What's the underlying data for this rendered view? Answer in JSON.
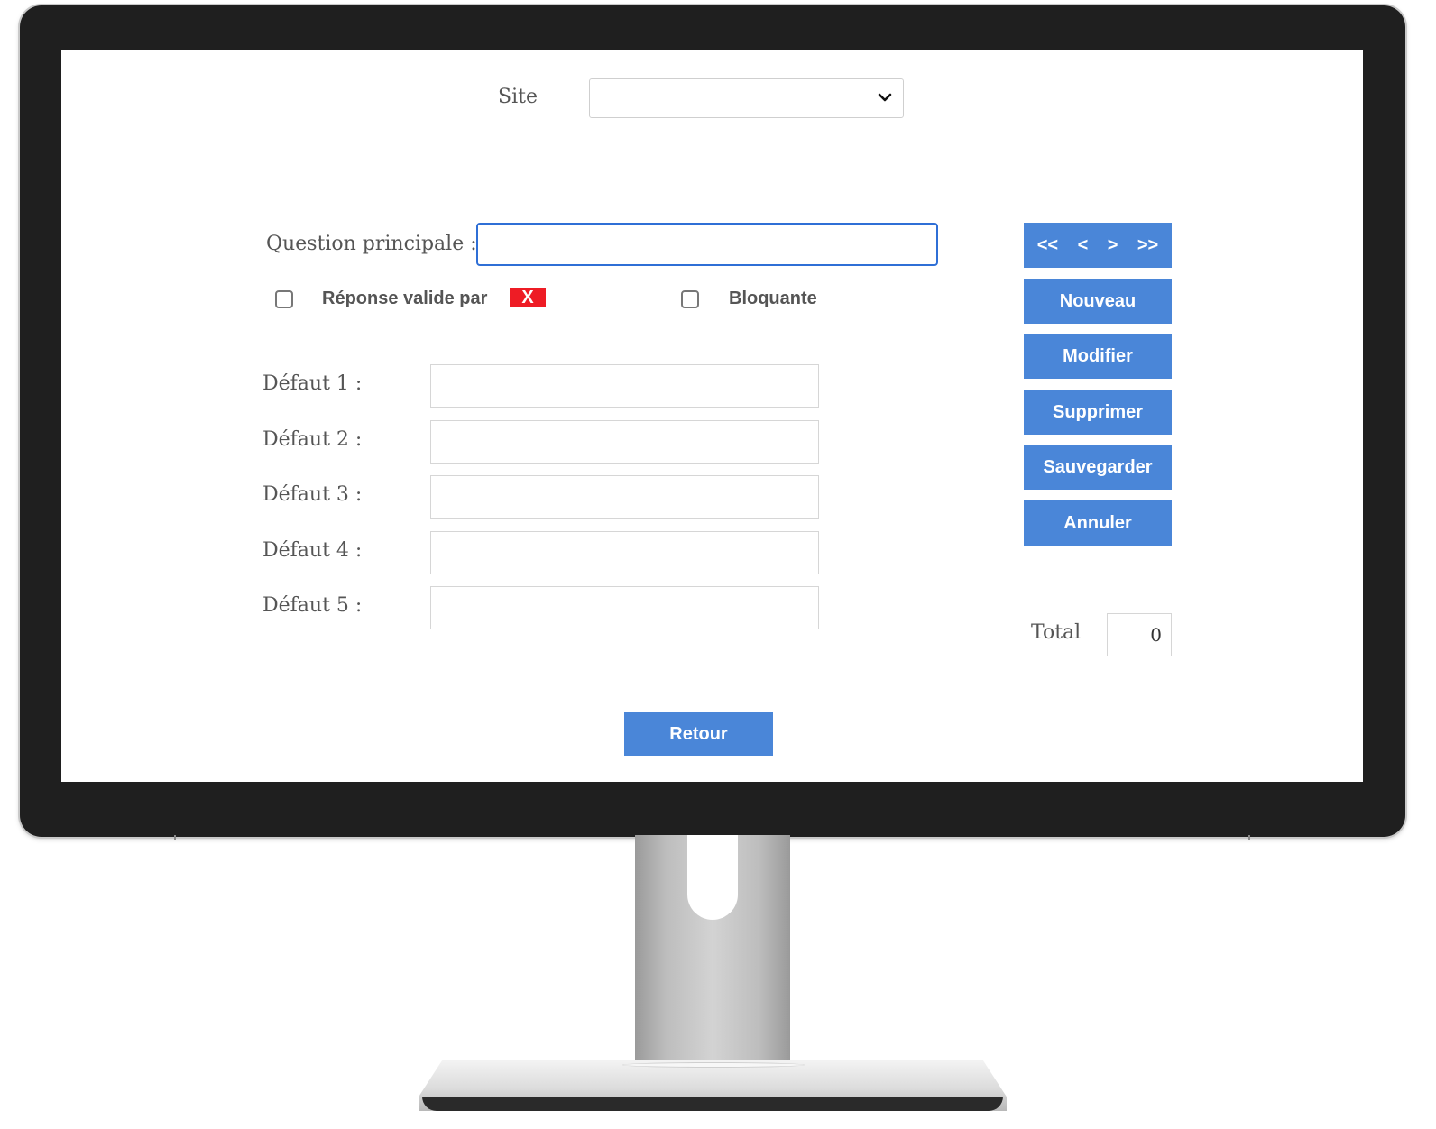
{
  "form": {
    "site_label": "Site",
    "site_value": "",
    "question_label": "Question principale :",
    "question_value": "",
    "valid_response_label": "Réponse valide par",
    "valid_response_badge": "X",
    "blocking_label": "Bloquante",
    "defaults": [
      {
        "label": "Défaut 1 :",
        "value": ""
      },
      {
        "label": "Défaut 2 :",
        "value": ""
      },
      {
        "label": "Défaut 3 :",
        "value": ""
      },
      {
        "label": "Défaut 4 :",
        "value": ""
      },
      {
        "label": "Défaut 5 :",
        "value": ""
      }
    ]
  },
  "navigation": {
    "first": "<<",
    "previous": "<",
    "next": ">",
    "last": ">>"
  },
  "actions": {
    "new": "Nouveau",
    "edit": "Modifier",
    "delete": "Supprimer",
    "save": "Sauvegarder",
    "cancel": "Annuler"
  },
  "total": {
    "label": "Total",
    "value": "0"
  },
  "footer": {
    "back": "Retour"
  },
  "colors": {
    "button_blue": "#4a86d8",
    "badge_red": "#ee1c25",
    "focus_blue": "#2f6fd6",
    "bezel": "#1f1f1f"
  }
}
